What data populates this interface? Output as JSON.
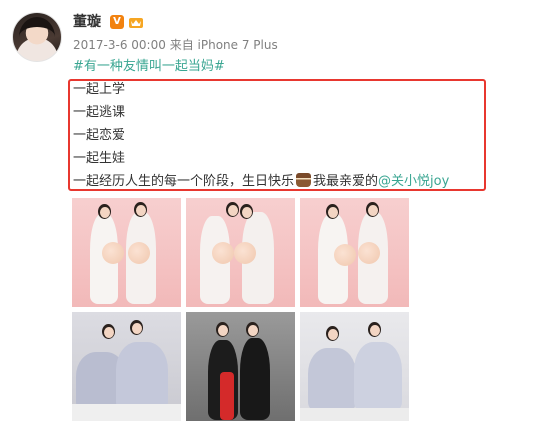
{
  "post": {
    "author": "董璇",
    "vip_badge": "V",
    "timestamp": "2017-3-6 00:00",
    "source": "来自 iPhone 7 Plus",
    "topic": "#有一种友情叫一起当妈#",
    "lines": [
      "一起上学",
      "一起逃课",
      "一起恋爱",
      "一起生娃"
    ],
    "last_line_prefix": "一起经历人生的每一个阶段，生日快乐",
    "last_line_middle": "我最亲爱的",
    "mention": "@关小悦joy"
  },
  "icons": {
    "vip": "verified-badge-icon",
    "member": "member-crown-icon",
    "emoji": "cake-emoji-icon"
  },
  "colors": {
    "link": "#3aa692",
    "highlight_border": "#e8372f",
    "vip_badge": "#f2820f"
  },
  "photos": [
    {
      "id": "photo-1",
      "scene": "pink-backdrop"
    },
    {
      "id": "photo-2",
      "scene": "pink-backdrop"
    },
    {
      "id": "photo-3",
      "scene": "pink-backdrop"
    },
    {
      "id": "photo-4",
      "scene": "white-dress-lounge"
    },
    {
      "id": "photo-5",
      "scene": "studio-two-women"
    },
    {
      "id": "photo-6",
      "scene": "white-dress-lounge"
    }
  ]
}
